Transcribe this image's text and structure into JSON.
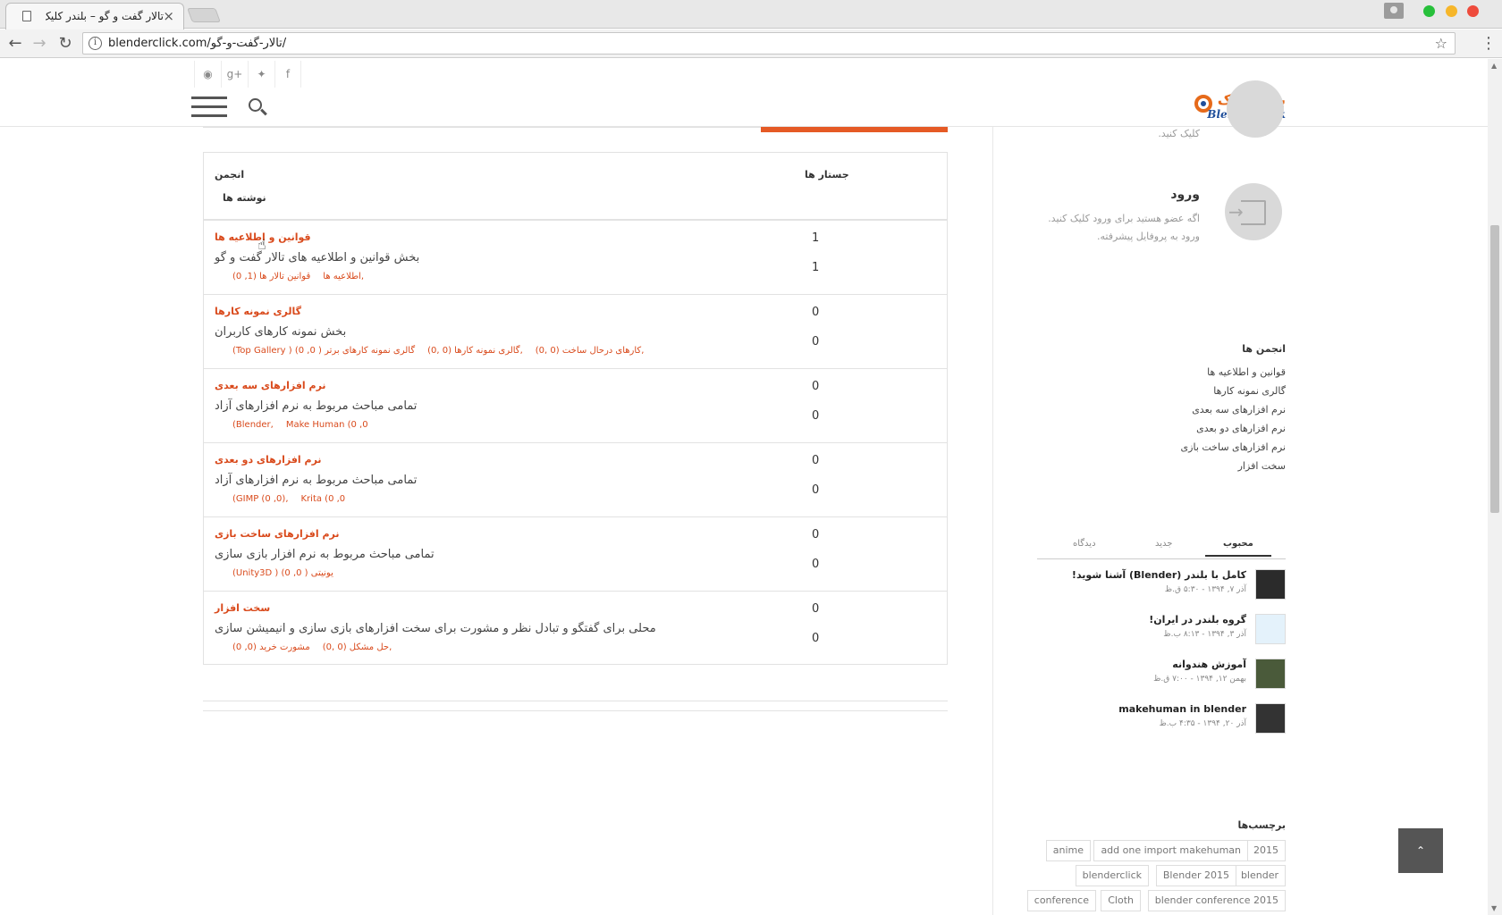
{
  "browser": {
    "tab_title": "تالار گفت و گو – بلندر کلیک",
    "url": "blenderclick.com/تالار-گفت-و-گو/",
    "colors": {
      "close": "#ee4b3c",
      "minimize": "#f6b62a",
      "maximize": "#27c03b"
    }
  },
  "header": {
    "logo_text_fa": "بلندرکلیک",
    "logo_text_en": "BlenderClick",
    "social_icons": [
      "rss-icon",
      "google-plus-icon",
      "twitter-icon",
      "facebook-icon"
    ]
  },
  "forum": {
    "head": {
      "forum_label": "انجمن",
      "posts_label": "نوشته ها",
      "topics_label": "جستار ها"
    },
    "rows": [
      {
        "title": "قوانین و اطلاعیه ها",
        "desc": "بخش قوانین و اطلاعیه های تالار گفت و گو",
        "topics": "1",
        "posts": "1",
        "subs": [
          "(0 ,1) قوانین تالار ها",
          "اطلاعیه ها,"
        ]
      },
      {
        "title": "گالری نمونه کارها",
        "desc": "بخش نمونه کارهای کاربران",
        "topics": "0",
        "posts": "0",
        "subs": [
          "(Top Gallery ) (0 ,0 ) گالری نمونه کارهای برتر",
          "گالری نمونه کارها (0 ,0),",
          "کارهای درحال ساخت (0 ,0),"
        ]
      },
      {
        "title": "نرم افزارهای سه بعدی",
        "desc": "تمامی مباحث مربوط به نرم افزارهای آزاد",
        "topics": "0",
        "posts": "0",
        "subs": [
          "(Blender,",
          "Make Human (0 ,0"
        ]
      },
      {
        "title": "نرم افزارهای دو بعدی",
        "desc": "تمامی مباحث مربوط به نرم افزارهای آزاد",
        "topics": "0",
        "posts": "0",
        "subs": [
          "(GIMP (0 ,0),",
          "Krita (0 ,0"
        ]
      },
      {
        "title": "نرم افزارهای ساخت بازی",
        "desc": "تمامی مباحث مربوط به نرم افزار بازی سازی",
        "topics": "0",
        "posts": "0",
        "subs": [
          "(Unity3D ) (0 ,0 ) یونیتی"
        ]
      },
      {
        "title": "سخت افزار",
        "desc": "محلی برای گفتگو و تبادل نظر و مشورت برای سخت افزارهای بازی سازی و انیمیشن سازی",
        "topics": "0",
        "posts": "0",
        "subs": [
          "(0 ,0) مشورت خرید",
          "حل مشکل (0 ,0),"
        ]
      }
    ]
  },
  "sidebar": {
    "register_hint": "کلیک کنید.",
    "login_title": "ورود",
    "login_line1": "اگه عضو هستید برای ورود کلیک کنید.",
    "login_line2": "ورود به پروفایل پیشرفته.",
    "forums_title": "انجمن ها",
    "forums": [
      "قوانین و اطلاعیه ها",
      "گالری نمونه کارها",
      "نرم افزارهای سه بعدی",
      "نرم افزارهای دو بعدی",
      "نرم افزارهای ساخت بازی",
      "سخت افزار"
    ],
    "tabs": {
      "popular": "محبوب",
      "new": "جدید",
      "comments": "دیدگاه"
    },
    "posts": [
      {
        "title": "کامل با بلندر (Blender) آشنا شوید!",
        "date": "آذر ۷, ۱۳۹۴ - ۵:۳۰ ق.ظ"
      },
      {
        "title": "گروه بلندر در ایران!",
        "date": "آذر ۳, ۱۳۹۴ - ۸:۱۳ ب.ظ"
      },
      {
        "title": "آموزش هندوانه",
        "date": "بهمن ۱۲, ۱۳۹۴ - ۷:۰۰ ق.ظ"
      },
      {
        "title": "makehuman in blender",
        "date": "آذر ۲۰, ۱۳۹۴ - ۴:۳۵ ب.ظ"
      }
    ],
    "tags_title": "برچسب‌ها",
    "tags": [
      [
        "2015",
        "add one import makehuman",
        "anime"
      ],
      [
        "blender",
        "Blender 2015",
        "blenderclick"
      ],
      [
        "blender conference 2015",
        "Cloth",
        "conference"
      ]
    ]
  },
  "to_top": "⌃"
}
